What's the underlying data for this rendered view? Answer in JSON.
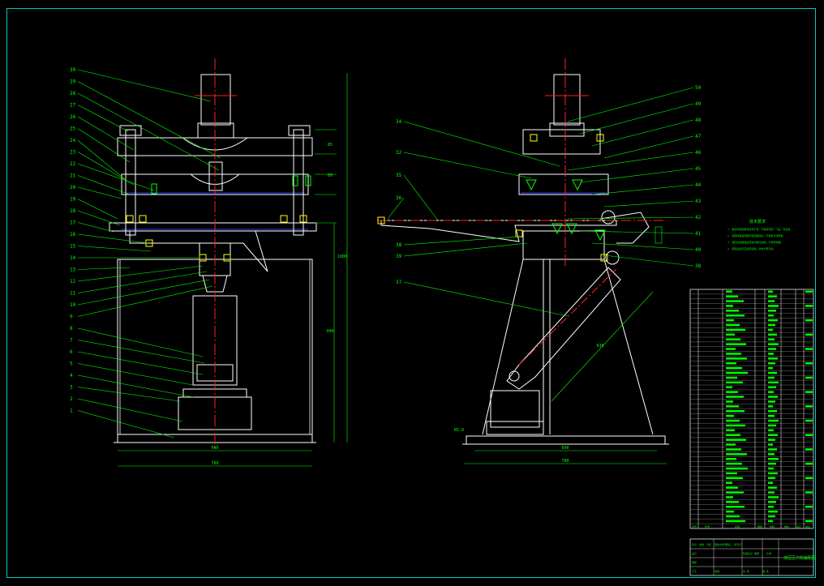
{
  "colors": {
    "background": "#000000",
    "outline": "#ffffff",
    "centerline": "#ff2020",
    "dimension": "#00ff00",
    "frame": "#00c8c8",
    "hidden": "#3040ff",
    "accent": "#ffff00"
  },
  "front_view": {
    "callouts": [
      "30",
      "29",
      "28",
      "27",
      "26",
      "25",
      "24",
      "23",
      "22",
      "21",
      "20",
      "19",
      "18",
      "17",
      "16",
      "15",
      "14",
      "13",
      "12",
      "11",
      "10",
      "9",
      "8",
      "7",
      "6",
      "5",
      "4",
      "3",
      "2",
      "1"
    ],
    "dims": {
      "overall_width": "780",
      "base_width": "660",
      "height_total": "1800",
      "height_lower": "900",
      "upper_a": "85",
      "upper_b": "60"
    }
  },
  "side_view": {
    "callouts_left": [
      "34",
      "32",
      "35",
      "36",
      "38",
      "39",
      "37"
    ],
    "callouts_right": [
      "50",
      "49",
      "48",
      "47",
      "46",
      "45",
      "44",
      "43",
      "42",
      "41",
      "40",
      "38"
    ],
    "dims": {
      "base_width": "600",
      "overall_width": "780",
      "arm_length": "630",
      "side_note": "R5.0"
    }
  },
  "notes": {
    "title": "技术要求",
    "lines": [
      "1. 各零件装配前须清洗干净，不得有毛刺、飞边、氧化皮。",
      "2. 装配时各运动部件须润滑良好，不得有卡滞现象。",
      "3. 液压系统装配后须进行耐压试验，不得有泄漏。",
      "4. 装配后进行空运转试验，动作平稳可靠。"
    ]
  },
  "title_block": {
    "drawing_title": "液压压力机装配图",
    "labels": [
      "标记",
      "处数",
      "分区",
      "更改文件号",
      "签名",
      "年月日",
      "设计",
      "审核",
      "工艺",
      "批准",
      "阶段标记",
      "重量",
      "比例",
      "共 张",
      "第 张"
    ],
    "bom_header": [
      "序号",
      "代号",
      "名称",
      "数量",
      "材料",
      "单件",
      "总计",
      "备注"
    ]
  }
}
